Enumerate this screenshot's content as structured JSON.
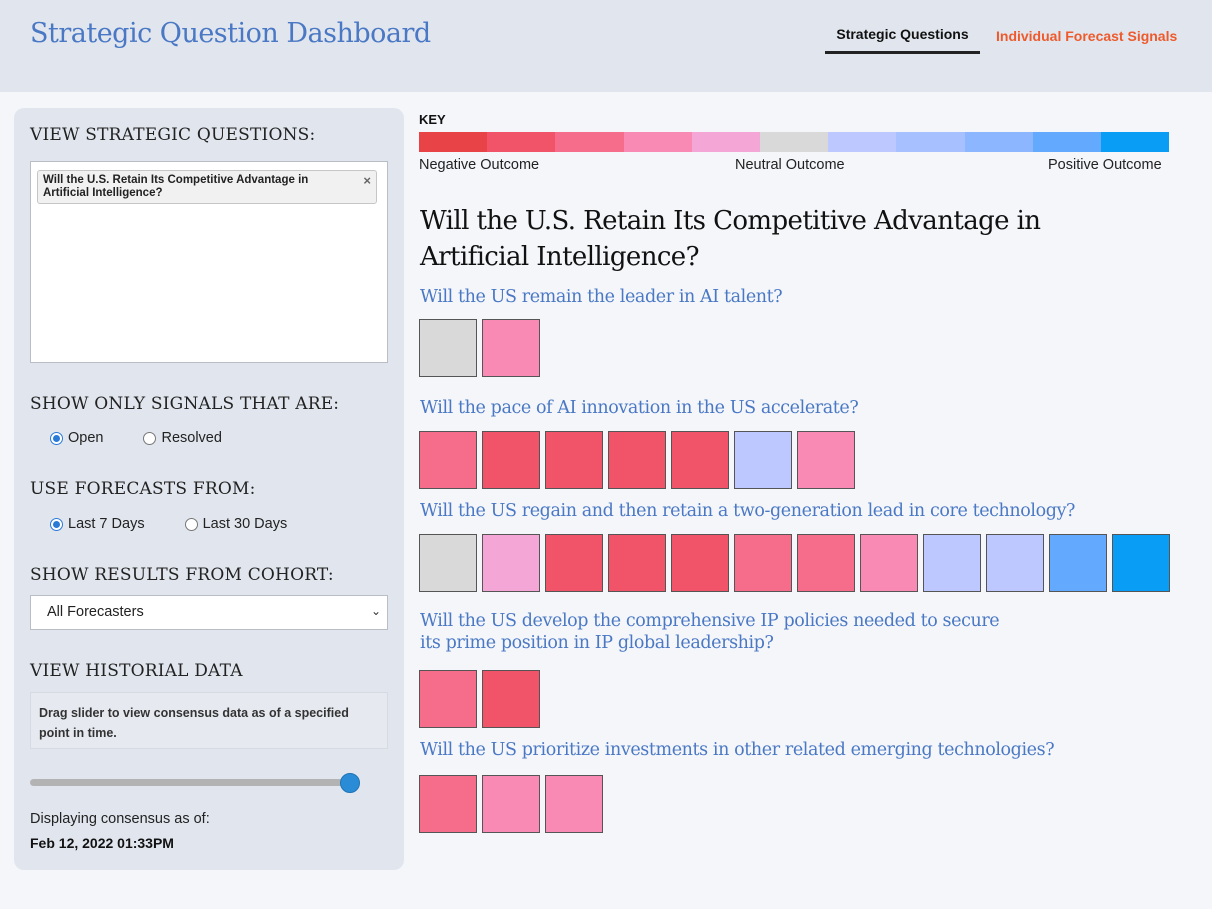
{
  "app_title": "Strategic Question Dashboard",
  "tabs": [
    {
      "label": "Strategic Questions",
      "active": true
    },
    {
      "label": "Individual Forecast Signals",
      "active": false
    }
  ],
  "sidebar": {
    "view_title": "VIEW STRATEGIC QUESTIONS:",
    "selected_question": "Will the U.S. Retain Its Competitive Advantage in Artificial Intelligence?",
    "chip_close": "×",
    "signals_title": "SHOW ONLY SIGNALS THAT ARE:",
    "signals_options": [
      {
        "label": "Open",
        "checked": true
      },
      {
        "label": "Resolved",
        "checked": false
      }
    ],
    "forecasts_title": "USE FORECASTS FROM:",
    "forecasts_options": [
      {
        "label": "Last 7 Days",
        "checked": true
      },
      {
        "label": "Last 30 Days",
        "checked": false
      }
    ],
    "cohort_title": "SHOW RESULTS FROM COHORT:",
    "cohort_value": "All Forecasters",
    "cohort_arrow": "⌄",
    "historical_title": "VIEW HISTORIAL DATA",
    "historical_hint": "Drag slider to view consensus data as of a specified point in time.",
    "slider_fraction": 1.0,
    "consensus_label": "Displaying consensus as of:",
    "consensus_date": "Feb 12, 2022 01:33PM"
  },
  "key": {
    "label": "KEY",
    "colors": [
      "#e84346",
      "#f15468",
      "#f66d8c",
      "#f98ab3",
      "#f4a6d6",
      "#d9d9d9",
      "#bcc8ff",
      "#a7c0ff",
      "#8cb6ff",
      "#63aaff",
      "#0a9df6"
    ],
    "negative": "Negative Outcome",
    "neutral": "Neutral Outcome",
    "positive": "Positive Outcome"
  },
  "main": {
    "title": "Will the U.S. Retain Its Competitive Advantage in Artificial Intelligence?",
    "questions": [
      {
        "text": "Will the US remain the leader in AI talent?",
        "signals": [
          5,
          3
        ]
      },
      {
        "text": "Will the pace of AI innovation in the US accelerate?",
        "signals": [
          2,
          1,
          1,
          1,
          1,
          6,
          3
        ]
      },
      {
        "text": "Will the US regain and then retain a two-generation lead in core technology?",
        "signals": [
          5,
          4,
          1,
          1,
          1,
          2,
          2,
          3,
          6,
          6,
          9,
          10
        ]
      },
      {
        "text": "Will the US develop the comprehensive IP policies needed to secure its prime position in IP global leadership?",
        "signals": [
          2,
          1
        ]
      },
      {
        "text": "Will the US prioritize investments in other related emerging technologies?",
        "signals": [
          2,
          3,
          3
        ]
      }
    ]
  }
}
